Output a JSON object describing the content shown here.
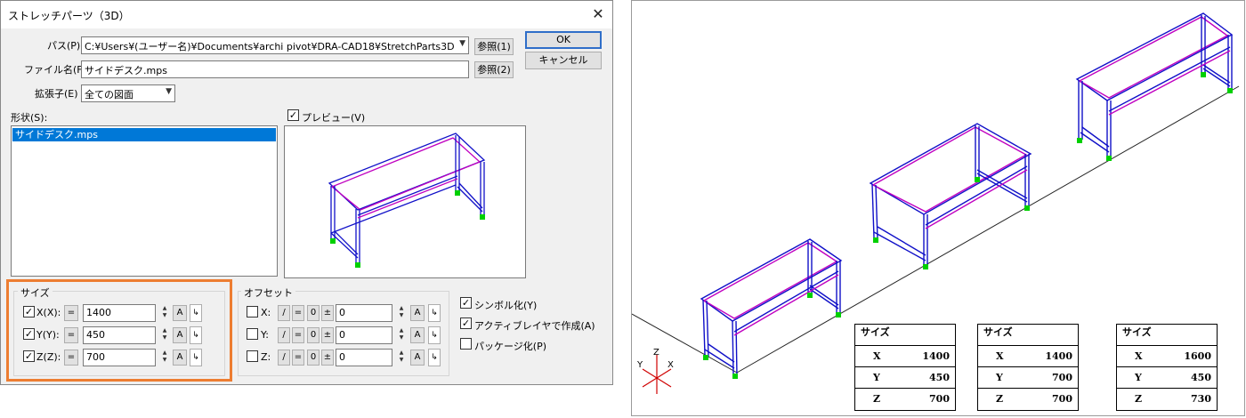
{
  "dialog": {
    "title": "ストレッチパーツ（3D）",
    "path_label": "パス(P)",
    "path_value": "C:¥Users¥(ユーザー名)¥Documents¥archi pivot¥DRA-CAD18¥StretchParts3D",
    "browse1": "参照(1)",
    "filename_label": "ファイル名(F)",
    "filename_value": "サイドデスク.mps",
    "browse2": "参照(2)",
    "ext_label": "拡張子(E)",
    "ext_value": "全ての図面",
    "ok": "OK",
    "cancel": "キャンセル",
    "shape_label": "形状(S):",
    "shape_items": [
      "サイドデスク.mps"
    ],
    "preview_label": "プレビュー(V)",
    "size": {
      "title": "サイズ",
      "rows": [
        {
          "label": "X(X):",
          "eq": "=",
          "value": "1400",
          "a": "A"
        },
        {
          "label": "Y(Y):",
          "eq": "=",
          "value": "450",
          "a": "A"
        },
        {
          "label": "Z(Z):",
          "eq": "=",
          "value": "700",
          "a": "A"
        }
      ]
    },
    "offset": {
      "title": "オフセット",
      "rows": [
        {
          "label": "X:",
          "div": "/",
          "eq": "=",
          "zero": "0",
          "pm": "±",
          "value": "0",
          "a": "A"
        },
        {
          "label": "Y:",
          "div": "/",
          "eq": "=",
          "zero": "0",
          "pm": "±",
          "value": "0",
          "a": "A"
        },
        {
          "label": "Z:",
          "div": "/",
          "eq": "=",
          "zero": "0",
          "pm": "±",
          "value": "0",
          "a": "A"
        }
      ]
    },
    "options": [
      {
        "label": "シンボル化(Y)",
        "checked": true
      },
      {
        "label": "アクティブレイヤで作成(A)",
        "checked": true
      },
      {
        "label": "パッケージ化(P)",
        "checked": false
      }
    ]
  },
  "axes": {
    "z": "Z",
    "y": "Y",
    "x": "X"
  },
  "tables": [
    {
      "title": "サイズ",
      "rows": [
        {
          "k": "X",
          "v": "1400"
        },
        {
          "k": "Y",
          "v": "450"
        },
        {
          "k": "Z",
          "v": "700"
        }
      ]
    },
    {
      "title": "サイズ",
      "rows": [
        {
          "k": "X",
          "v": "1400"
        },
        {
          "k": "Y",
          "v": "700"
        },
        {
          "k": "Z",
          "v": "700"
        }
      ]
    },
    {
      "title": "サイズ",
      "rows": [
        {
          "k": "X",
          "v": "1600"
        },
        {
          "k": "Y",
          "v": "450"
        },
        {
          "k": "Z",
          "v": "730"
        }
      ]
    }
  ],
  "colors": {
    "frame": "#1010c8",
    "top": "#c000c0",
    "foot": "#00d000",
    "highlight": "#ed7d31"
  }
}
